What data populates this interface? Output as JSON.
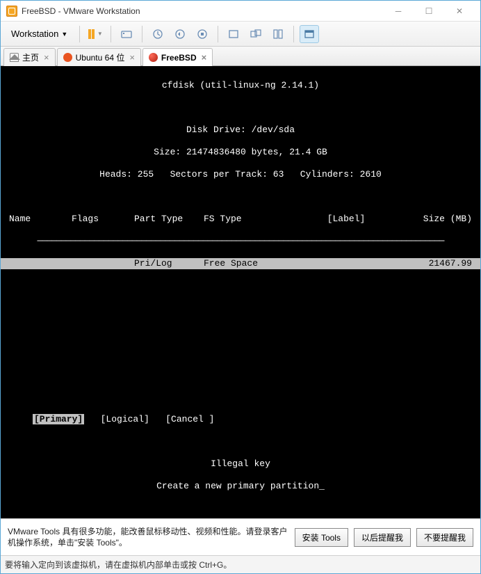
{
  "window": {
    "title": "FreeBSD - VMware Workstation"
  },
  "toolbar": {
    "menu_label": "Workstation"
  },
  "tabs": {
    "home": "主页",
    "ubuntu": "Ubuntu 64 位",
    "freebsd": "FreeBSD"
  },
  "console": {
    "title": "cfdisk (util-linux-ng 2.14.1)",
    "drive": "Disk Drive: /dev/sda",
    "size": "Size: 21474836480 bytes, 21.4 GB",
    "geom": "Heads: 255   Sectors per Track: 63   Cylinders: 2610",
    "headers": {
      "name": "Name",
      "flags": "Flags",
      "part": "Part Type",
      "fs": "FS Type",
      "label": "[Label]",
      "size": "Size (MB)"
    },
    "row": {
      "part": "Pri/Log",
      "fs": "Free Space",
      "size": "21467.99"
    },
    "cmds": {
      "primary": "[Primary]",
      "logical": "[Logical]",
      "cancel": "[Cancel ]"
    },
    "warn": "Illegal key",
    "hint": "Create a new primary partition_"
  },
  "tools": {
    "msg": "VMware Tools 具有很多功能，能改善鼠标移动性、视频和性能。请登录客户机操作系统，单击\"安装 Tools\"。",
    "install": "安装 Tools",
    "later": "以后提醒我",
    "never": "不要提醒我"
  },
  "status": {
    "text": "要将输入定向到该虚拟机，请在虚拟机内部单击或按 Ctrl+G。"
  }
}
